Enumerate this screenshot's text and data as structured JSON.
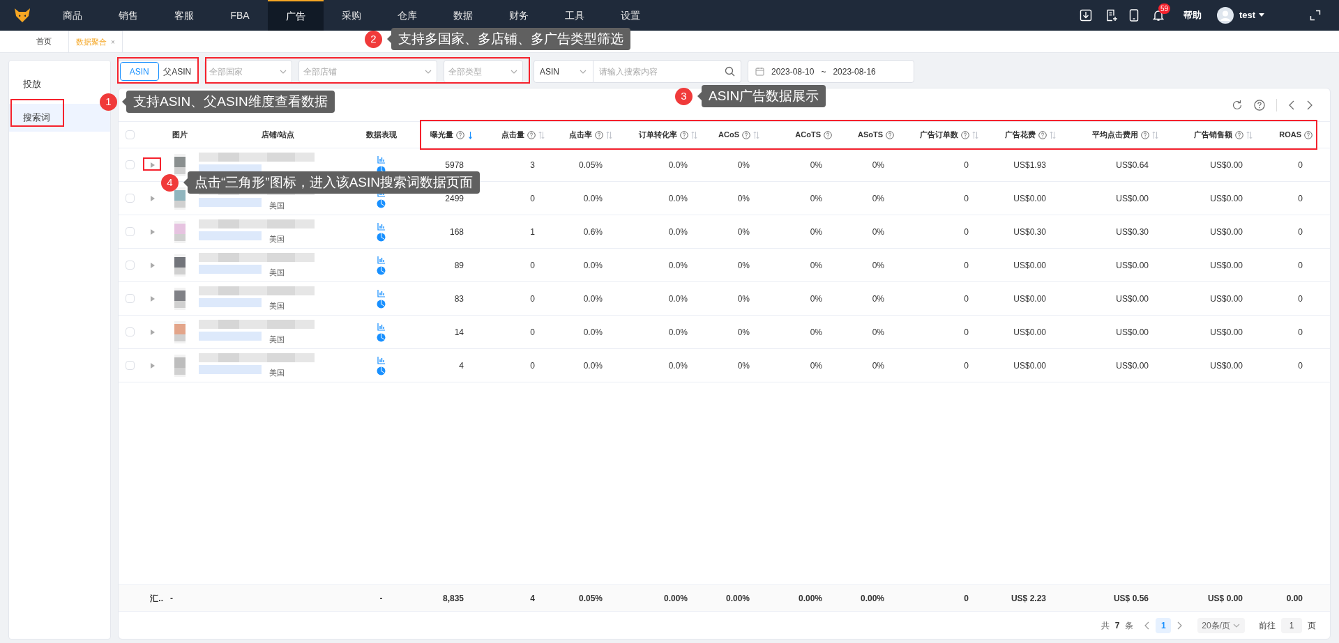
{
  "nav": {
    "items": [
      {
        "label": "商品",
        "selected": false
      },
      {
        "label": "销售",
        "selected": false
      },
      {
        "label": "客服",
        "selected": false
      },
      {
        "label": "FBA",
        "selected": false
      },
      {
        "label": "广告",
        "selected": true
      },
      {
        "label": "采购",
        "selected": false
      },
      {
        "label": "仓库",
        "selected": false
      },
      {
        "label": "数据",
        "selected": false
      },
      {
        "label": "财务",
        "selected": false
      },
      {
        "label": "工具",
        "selected": false
      },
      {
        "label": "设置",
        "selected": false
      }
    ],
    "notifications": "59",
    "help": "帮助",
    "user": "test"
  },
  "tabs": [
    {
      "label": "首页",
      "selected": false
    },
    {
      "label": "数据聚合",
      "selected": true,
      "close": "×"
    }
  ],
  "sidebar": {
    "items": [
      {
        "label": "投放",
        "selected": false
      },
      {
        "label": "搜索词",
        "selected": true
      }
    ]
  },
  "filters": {
    "dimension": [
      {
        "label": "ASIN",
        "selected": true
      },
      {
        "label": "父ASIN",
        "selected": false
      }
    ],
    "selects": [
      {
        "placeholder": "全部国家"
      },
      {
        "placeholder": "全部店铺"
      },
      {
        "placeholder": "全部类型"
      }
    ],
    "search_type": "ASIN",
    "search": {
      "placeholder": "请输入搜索内容"
    },
    "date_start": "2023-08-10",
    "date_separator": "~",
    "date_end": "2023-08-16"
  },
  "table": {
    "all_checked": false,
    "columns": [
      {
        "label": "图片"
      },
      {
        "label": "店铺/站点"
      },
      {
        "label": "数据表现"
      },
      {
        "label": "曝光量",
        "help": true,
        "sortable": true,
        "sorted_descending": true
      },
      {
        "label": "点击量",
        "help": true,
        "sortable": true,
        "sorted_descending": false
      },
      {
        "label": "点击率",
        "help": true,
        "sortable": true,
        "sorted_descending": false
      },
      {
        "label": "订单转化率",
        "help": true,
        "sortable": true,
        "sorted_descending": false
      },
      {
        "label": "ACoS",
        "help": true,
        "sortable": true,
        "sorted_descending": false
      },
      {
        "label": "ACoTS",
        "help": true
      },
      {
        "label": "ASoTS",
        "help": true
      },
      {
        "label": "广告订单数",
        "help": true,
        "sortable": true,
        "sorted_descending": false
      },
      {
        "label": "广告花费",
        "help": true,
        "sortable": true,
        "sorted_descending": false
      },
      {
        "label": "平均点击费用",
        "help": true,
        "sortable": true,
        "sorted_descending": false
      },
      {
        "label": "广告销售额",
        "help": true,
        "sortable": true,
        "sorted_descending": false
      },
      {
        "label": "ROAS",
        "help": true
      }
    ],
    "rows": [
      {
        "checked": false,
        "values": [
          "5978",
          "3",
          "0.05%",
          "0.0%",
          "0%",
          "0%",
          "0%",
          "0",
          "US$1.93",
          "US$0.64",
          "US$0.00",
          "0"
        ]
      },
      {
        "checked": false,
        "country": "美国",
        "values": [
          "2499",
          "0",
          "0.0%",
          "0.0%",
          "0%",
          "0%",
          "0%",
          "0",
          "US$0.00",
          "US$0.00",
          "US$0.00",
          "0"
        ]
      },
      {
        "checked": false,
        "country": "美国",
        "values": [
          "168",
          "1",
          "0.6%",
          "0.0%",
          "0%",
          "0%",
          "0%",
          "0",
          "US$0.30",
          "US$0.30",
          "US$0.00",
          "0"
        ]
      },
      {
        "checked": false,
        "country": "美国",
        "values": [
          "89",
          "0",
          "0.0%",
          "0.0%",
          "0%",
          "0%",
          "0%",
          "0",
          "US$0.00",
          "US$0.00",
          "US$0.00",
          "0"
        ]
      },
      {
        "checked": false,
        "country": "美国",
        "values": [
          "83",
          "0",
          "0.0%",
          "0.0%",
          "0%",
          "0%",
          "0%",
          "0",
          "US$0.00",
          "US$0.00",
          "US$0.00",
          "0"
        ]
      },
      {
        "checked": false,
        "country": "美国",
        "values": [
          "14",
          "0",
          "0.0%",
          "0.0%",
          "0%",
          "0%",
          "0%",
          "0",
          "US$0.00",
          "US$0.00",
          "US$0.00",
          "0"
        ]
      },
      {
        "checked": false,
        "country": "美国",
        "values": [
          "4",
          "0",
          "0.0%",
          "0.0%",
          "0%",
          "0%",
          "0%",
          "0",
          "US$0.00",
          "US$0.00",
          "US$0.00",
          "0"
        ]
      }
    ],
    "summary": {
      "label": "汇..",
      "image": "-",
      "data": "-",
      "values": [
        "8,835",
        "4",
        "0.05%",
        "0.00%",
        "0.00%",
        "0.00%",
        "0.00%",
        "0",
        "US$ 2.23",
        "US$ 0.56",
        "US$ 0.00",
        "0.00"
      ]
    }
  },
  "pagination": {
    "total_prefix": "共",
    "total": "7",
    "total_suffix": "条",
    "pages": [
      {
        "label": "1",
        "selected": true
      }
    ],
    "page_size": "20条/页",
    "goto_prefix": "前往",
    "goto_value": "1",
    "goto_suffix": "页"
  },
  "annotations": [
    {
      "number": "1",
      "text": "支持ASIN、父ASIN维度查看数据"
    },
    {
      "number": "2",
      "text": "支持多国家、多店铺、多广告类型筛选"
    },
    {
      "number": "3",
      "text": "ASIN广告数据展示"
    },
    {
      "number": "4",
      "text": "点击“三角形”图标，进入该ASIN搜索词数据页面"
    }
  ]
}
